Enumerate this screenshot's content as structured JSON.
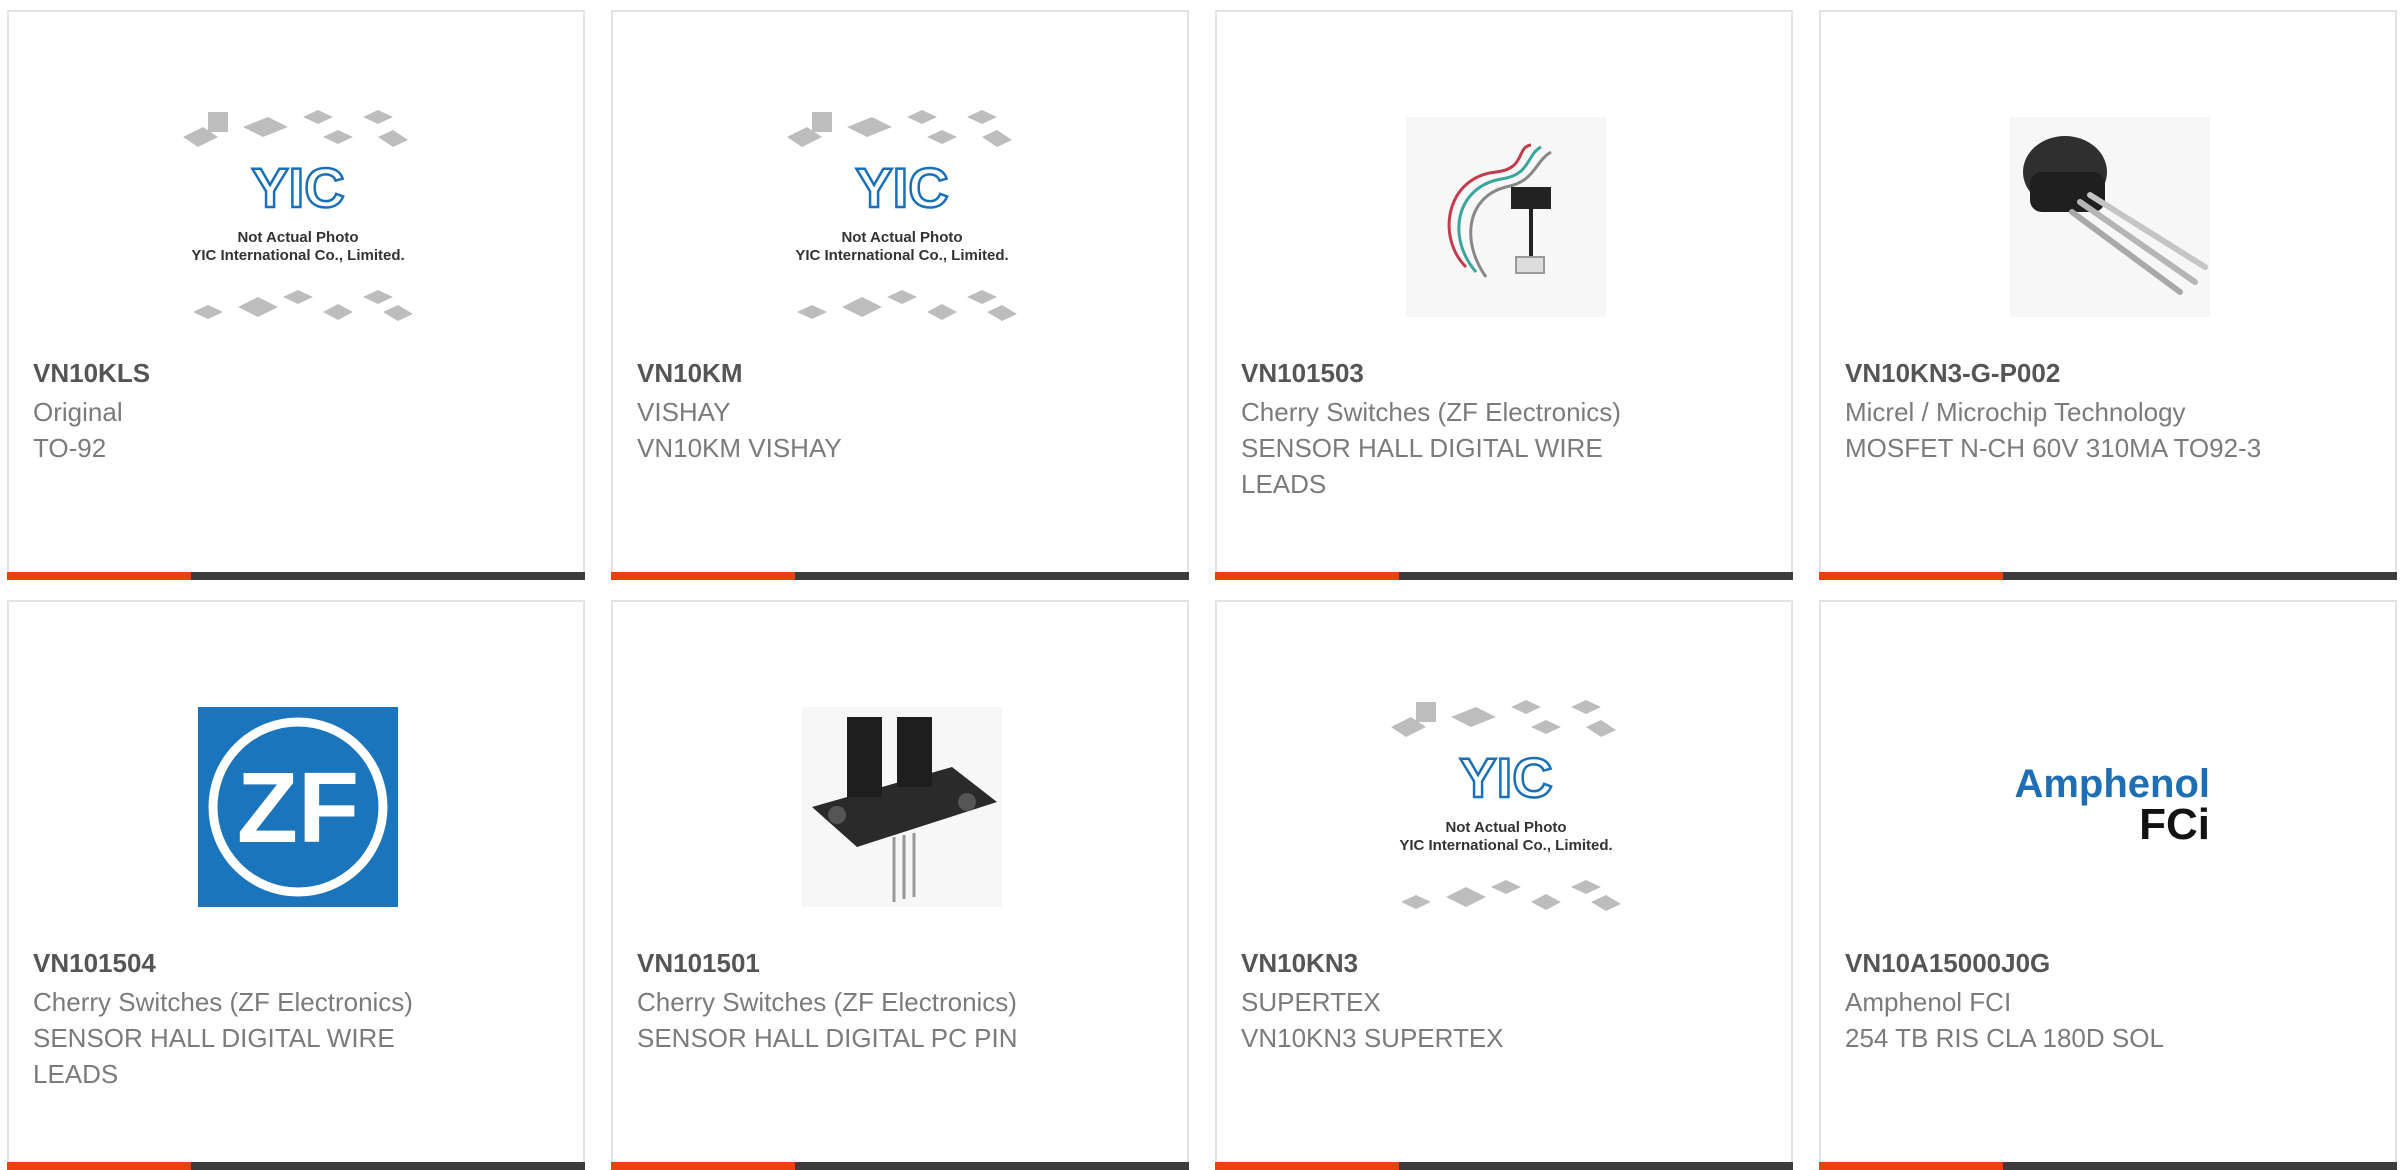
{
  "colors": {
    "accent": "#e8420e",
    "bar": "#3c3c3c",
    "border": "#e3e3e3",
    "part": "#555555",
    "text": "#7b7b7b"
  },
  "products": [
    {
      "part": "VN10KLS",
      "maker": "Original",
      "desc": "TO-92",
      "image": "placeholder-yic-image",
      "placeholder": {
        "line1": "Not Actual Photo",
        "line2": "YIC International Co., Limited.",
        "logo": "YIC"
      }
    },
    {
      "part": "VN10KM",
      "maker": "VISHAY",
      "desc": "VN10KM VISHAY",
      "image": "placeholder-yic-image",
      "placeholder": {
        "line1": "Not Actual Photo",
        "line2": "YIC International Co., Limited.",
        "logo": "YIC"
      }
    },
    {
      "part": "VN101503",
      "maker": "Cherry Switches (ZF Electronics)",
      "desc": "SENSOR HALL DIGITAL WIRE LEADS",
      "image": "wire-sensor-image"
    },
    {
      "part": "VN10KN3-G-P002",
      "maker": "Micrel / Microchip Technology",
      "desc": "MOSFET N-CH 60V 310MA TO92-3",
      "image": "to92-transistor-image"
    },
    {
      "part": "VN101504",
      "maker": "Cherry Switches (ZF Electronics)",
      "desc": "SENSOR HALL DIGITAL WIRE LEADS",
      "image": "zf-logo-image",
      "logo_text": "ZF"
    },
    {
      "part": "VN101501",
      "maker": "Cherry Switches (ZF Electronics)",
      "desc": "SENSOR HALL DIGITAL PC PIN",
      "image": "slot-sensor-image"
    },
    {
      "part": "VN10KN3",
      "maker": "SUPERTEX",
      "desc": "VN10KN3 SUPERTEX",
      "image": "placeholder-yic-image",
      "placeholder": {
        "line1": "Not Actual Photo",
        "line2": "YIC International Co., Limited.",
        "logo": "YIC"
      }
    },
    {
      "part": "VN10A15000J0G",
      "maker": "Amphenol FCI",
      "desc": "254 TB RIS CLA 180D SOL",
      "image": "amphenol-logo-image",
      "logo_text": {
        "line1": "Amphenol",
        "line2": "FCi"
      }
    }
  ]
}
